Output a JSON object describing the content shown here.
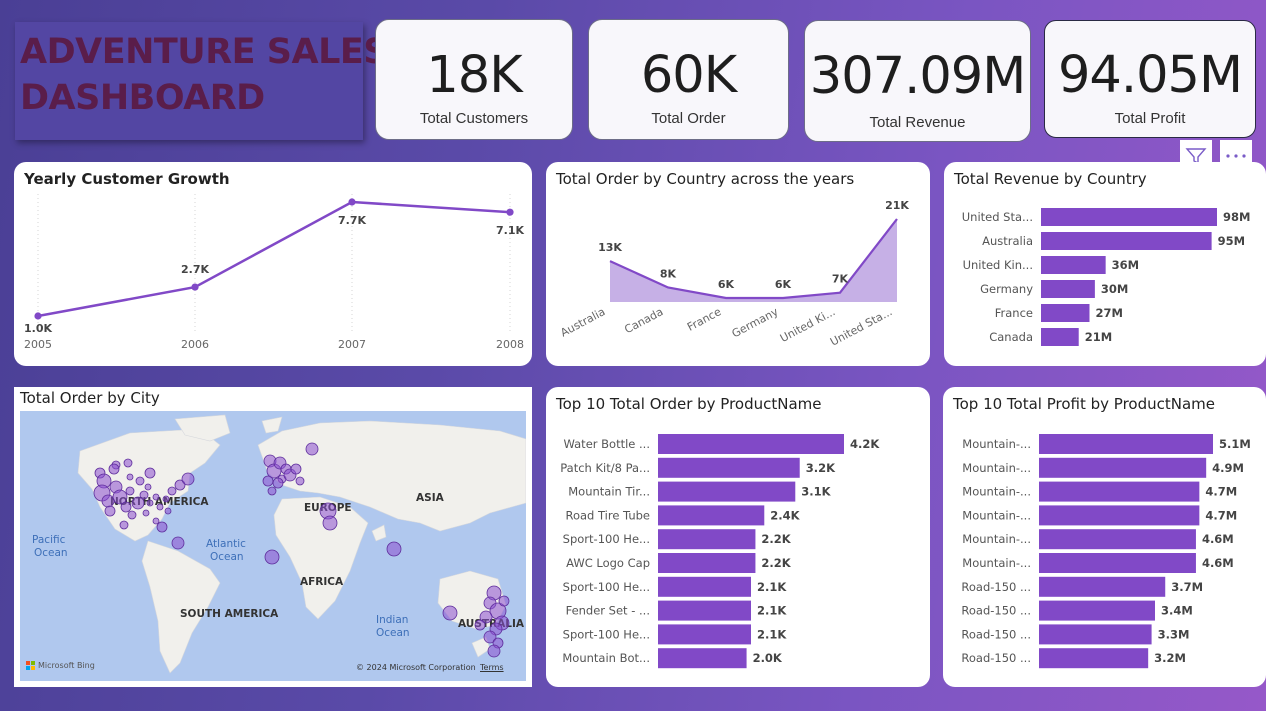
{
  "title": {
    "line1": "ADVENTURE SALES",
    "line2": "DASHBOARD"
  },
  "kpis": [
    {
      "value": "18K",
      "label": "Total Customers"
    },
    {
      "value": "60K",
      "label": "Total Order"
    },
    {
      "value": "307.09M",
      "label": "Total Revenue"
    },
    {
      "value": "94.05M",
      "label": "Total Profit"
    }
  ],
  "map": {
    "title": "Total Order by City",
    "labels": {
      "north_america": "NORTH AMERICA",
      "europe": "EUROPE",
      "asia": "ASIA",
      "africa": "AFRICA",
      "south_america": "SOUTH AMERICA",
      "australia": "AUSTRALIA",
      "pacific_1": "Pacific",
      "pacific_2": "Ocean",
      "atlantic_1": "Atlantic",
      "atlantic_2": "Ocean",
      "indian_1": "Indian",
      "indian_2": "Ocean"
    },
    "bing": "Microsoft Bing",
    "copyright": "© 2024 Microsoft Corporation",
    "terms": "Terms",
    "colors": {
      "water": "#b0c8ee",
      "land": "#f1f0ec",
      "bubble": "#8a4fd0"
    }
  },
  "chart_data": [
    {
      "type": "line",
      "title": "Yearly Customer Growth",
      "x": [
        "2005",
        "2006",
        "2007",
        "2008"
      ],
      "values": [
        1000,
        2700,
        7700,
        7100
      ],
      "data_labels": [
        "1.0K",
        "2.7K",
        "7.7K",
        "7.1K"
      ],
      "ylim": [
        1000,
        7700
      ],
      "color": "#8149c7"
    },
    {
      "type": "area",
      "title": "Total Order by Country across the years",
      "categories": [
        "Australia",
        "Canada",
        "France",
        "Germany",
        "United Ki...",
        "United Sta..."
      ],
      "values": [
        13000,
        8000,
        6000,
        6000,
        7000,
        21000
      ],
      "data_labels": [
        "13K",
        "8K",
        "6K",
        "6K",
        "7K",
        "21K"
      ],
      "ylim": [
        6000,
        21000
      ],
      "color": "#8149c7",
      "fill": "#c6b0e6"
    },
    {
      "type": "bar",
      "title": "Total Revenue by Country",
      "categories": [
        "United Sta...",
        "Australia",
        "United Kin...",
        "Germany",
        "France",
        "Canada"
      ],
      "values": [
        98,
        95,
        36,
        30,
        27,
        21
      ],
      "data_labels": [
        "98M",
        "95M",
        "36M",
        "30M",
        "27M",
        "21M"
      ],
      "unit": "M",
      "color": "#8149c7"
    },
    {
      "type": "bar",
      "title": "Top 10 Total Order by ProductName",
      "categories": [
        "Water Bottle ...",
        "Patch Kit/8 Pa...",
        "Mountain Tir...",
        "Road Tire Tube",
        "Sport-100 He...",
        "AWC Logo Cap",
        "Sport-100 He...",
        "Fender Set - ...",
        "Sport-100 He...",
        "Mountain Bot..."
      ],
      "values": [
        4.2,
        3.2,
        3.1,
        2.4,
        2.2,
        2.2,
        2.1,
        2.1,
        2.1,
        2.0
      ],
      "data_labels": [
        "4.2K",
        "3.2K",
        "3.1K",
        "2.4K",
        "2.2K",
        "2.2K",
        "2.1K",
        "2.1K",
        "2.1K",
        "2.0K"
      ],
      "unit": "K",
      "color": "#8149c7"
    },
    {
      "type": "bar",
      "title": "Top 10 Total Profit by ProductName",
      "categories": [
        "Mountain-...",
        "Mountain-...",
        "Mountain-...",
        "Mountain-...",
        "Mountain-...",
        "Mountain-...",
        "Road-150 ...",
        "Road-150 ...",
        "Road-150 ...",
        "Road-150 ..."
      ],
      "values": [
        5.1,
        4.9,
        4.7,
        4.7,
        4.6,
        4.6,
        3.7,
        3.4,
        3.3,
        3.2
      ],
      "data_labels": [
        "5.1M",
        "4.9M",
        "4.7M",
        "4.7M",
        "4.6M",
        "4.6M",
        "3.7M",
        "3.4M",
        "3.3M",
        "3.2M"
      ],
      "unit": "M",
      "color": "#8149c7"
    }
  ],
  "toolbar": {
    "filter_icon": "filter-icon",
    "more_icon": "more-options-icon"
  }
}
